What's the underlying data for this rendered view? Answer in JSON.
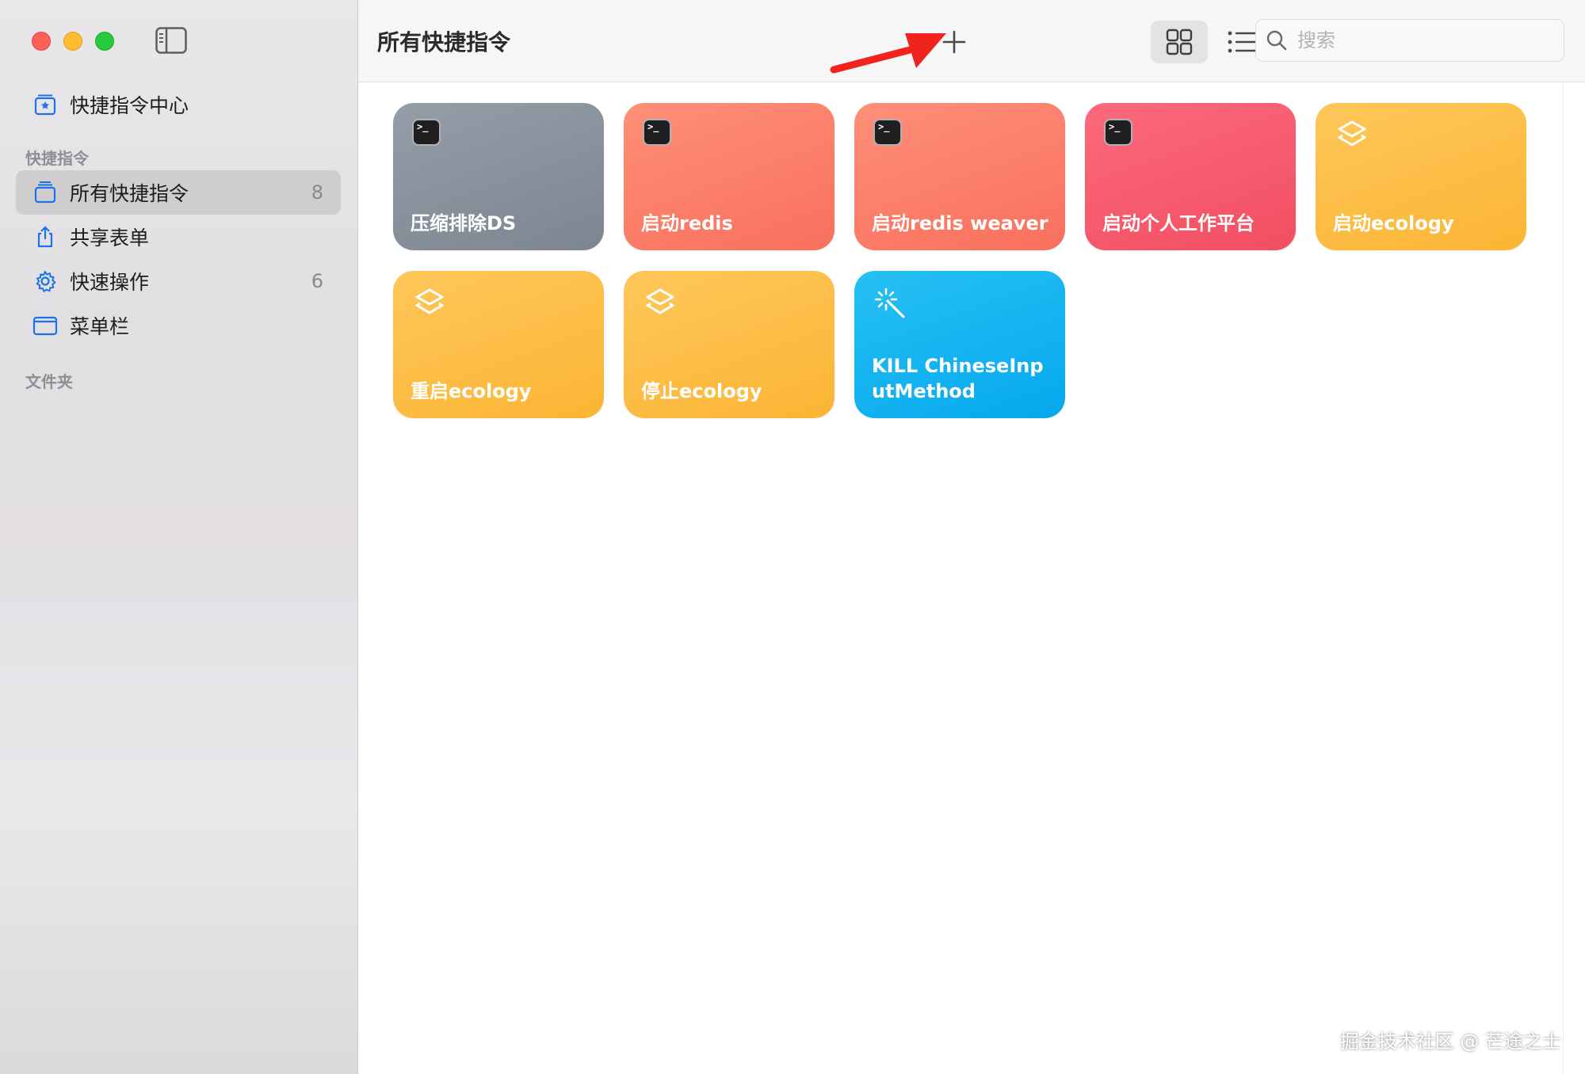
{
  "window": {
    "title": "所有快捷指令"
  },
  "sidebar": {
    "top_items": [
      {
        "label": "快捷指令中心",
        "icon": "gallery-icon"
      }
    ],
    "section_shortcuts": "快捷指令",
    "items": [
      {
        "label": "所有快捷指令",
        "count": "8",
        "icon": "all-shortcuts-icon",
        "active": true
      },
      {
        "label": "共享表单",
        "count": "",
        "icon": "share-icon"
      },
      {
        "label": "快速操作",
        "count": "6",
        "icon": "gear-icon"
      },
      {
        "label": "菜单栏",
        "count": "",
        "icon": "menubar-icon"
      }
    ],
    "section_folders": "文件夹"
  },
  "toolbar": {
    "search_placeholder": "搜索"
  },
  "shortcuts": [
    {
      "title": "压缩排除DS",
      "color": "gray",
      "icon": "terminal-icon"
    },
    {
      "title": "启动redis",
      "color": "salmon",
      "icon": "terminal-icon"
    },
    {
      "title": "启动redis weaver",
      "color": "salmon",
      "icon": "terminal-icon"
    },
    {
      "title": "启动个人工作平台",
      "color": "pink",
      "icon": "terminal-icon"
    },
    {
      "title": "启动ecology",
      "color": "yellow",
      "icon": "layers-icon"
    },
    {
      "title": "重启ecology",
      "color": "yellow",
      "icon": "layers-icon"
    },
    {
      "title": "停止ecology",
      "color": "yellow",
      "icon": "layers-icon"
    },
    {
      "title": "KILL ChineseInputMethod",
      "color": "blue",
      "icon": "magic-wand-icon"
    }
  ],
  "watermark": "掘金技术社区 @ 芒途之士",
  "colors": {
    "gray": "#8a939d",
    "salmon": "#fb7d68",
    "pink": "#f65b6f",
    "yellow": "#fcbe45",
    "blue": "#14b3f0",
    "accent": "#1a73e8",
    "arrow": "#f0231e"
  }
}
